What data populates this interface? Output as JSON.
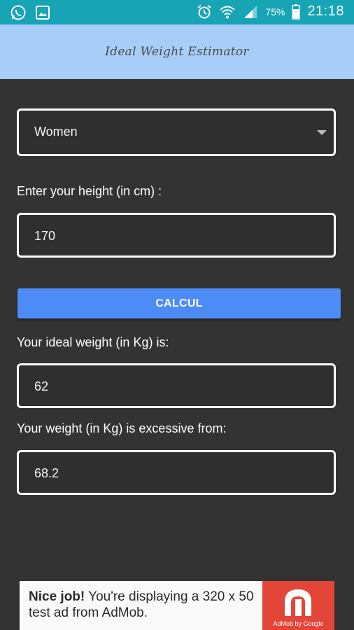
{
  "status_bar": {
    "battery_percent": "75%",
    "time": "21:18",
    "left_icons": [
      "whatsapp-icon",
      "gallery-icon"
    ],
    "right_icons": [
      "alarm-icon",
      "wifi-icon",
      "signal-icon",
      "battery-icon"
    ]
  },
  "app_bar": {
    "title": "Ideal Weight Estimator"
  },
  "form": {
    "gender_selected": "Women",
    "height_label": "Enter your height (in cm) :",
    "height_value": "170",
    "calc_button": "CALCUL",
    "ideal_label": "Your ideal weight (in Kg) is:",
    "ideal_value": "62",
    "excess_label": "Your weight (in Kg) is excessive from:",
    "excess_value": "68.2"
  },
  "ad": {
    "bold": "Nice job!",
    "text": " You're displaying a 320 x 50 test ad from AdMob.",
    "brand": "AdMob by Google"
  },
  "colors": {
    "status_bar": "#17a4b4",
    "app_bar": "#a7cdf8",
    "background": "#333333",
    "button": "#4d8bf6",
    "ad_logo": "#e44539"
  }
}
